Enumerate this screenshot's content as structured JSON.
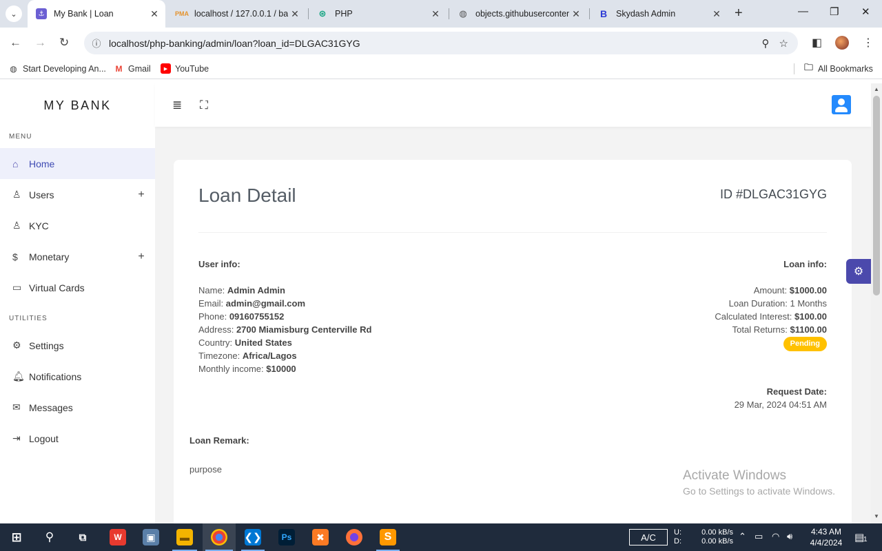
{
  "browser": {
    "tabs": [
      {
        "title": "My Bank | Loan",
        "favicon": "bank-favicon"
      },
      {
        "title": "localhost / 127.0.0.1 / ba",
        "favicon": "phpmyadmin-favicon"
      },
      {
        "title": "PHP",
        "favicon": "chatgpt-favicon"
      },
      {
        "title": "objects.githubusercontent",
        "favicon": "globe-favicon"
      },
      {
        "title": "Skydash Admin",
        "favicon": "bootstrap-favicon"
      }
    ],
    "url": "localhost/php-banking/admin/loan?loan_id=DLGAC31GYG",
    "bookmarks": [
      {
        "label": "Start Developing An..."
      },
      {
        "label": "Gmail"
      },
      {
        "label": "YouTube"
      }
    ],
    "all_bookmarks": "All Bookmarks"
  },
  "sidebar": {
    "brand": "MY BANK",
    "menu_title": "MENU",
    "utilities_title": "UTILITIES",
    "menu_items": [
      {
        "label": "Home",
        "icon": "home-icon"
      },
      {
        "label": "Users",
        "icon": "user-icon",
        "expandable": true
      },
      {
        "label": "KYC",
        "icon": "user-check-icon"
      },
      {
        "label": "Monetary",
        "icon": "dollar-icon",
        "expandable": true
      },
      {
        "label": "Virtual Cards",
        "icon": "card-icon"
      }
    ],
    "utility_items": [
      {
        "label": "Settings",
        "icon": "gear-icon"
      },
      {
        "label": "Notifications",
        "icon": "bell-icon"
      },
      {
        "label": "Messages",
        "icon": "inbox-icon"
      },
      {
        "label": "Logout",
        "icon": "logout-icon"
      }
    ]
  },
  "loan": {
    "title": "Loan Detail",
    "id_label": "ID #DLGAC31GYG",
    "user_info_title": "User info:",
    "user_info": [
      {
        "label": "Name:",
        "value": "Admin Admin"
      },
      {
        "label": "Email:",
        "value": "admin@gmail.com"
      },
      {
        "label": "Phone:",
        "value": "09160755152"
      },
      {
        "label": "Address:",
        "value": "2700 Miamisburg Centerville Rd"
      },
      {
        "label": "Country:",
        "value": "United States"
      },
      {
        "label": "Timezone:",
        "value": "Africa/Lagos"
      },
      {
        "label": "Monthly income:",
        "value": "$10000"
      }
    ],
    "loan_info_title": "Loan info:",
    "amount_label": "Amount:",
    "amount": "$1000.00",
    "duration_label": "Loan Duration:",
    "duration": "1 Months",
    "interest_label": "Calculated Interest:",
    "interest": "$100.00",
    "returns_label": "Total Returns:",
    "returns": "$1100.00",
    "status": "Pending",
    "request_date_label": "Request Date:",
    "request_date": "29 Mar, 2024 04:51 AM",
    "remark_title": "Loan Remark:",
    "remark": "purpose"
  },
  "watermark": {
    "line1": "Activate Windows",
    "line2": "Go to Settings to activate Windows."
  },
  "taskbar": {
    "ac_label": "A/C",
    "upload_label": "U:",
    "download_label": "D:",
    "upload": "0.00 kB/s",
    "download": "0.00 kB/s",
    "time": "4:43 AM",
    "date": "4/4/2024",
    "notification_count": "1"
  },
  "colors": {
    "accent": "#4b49ac",
    "badge_warning": "#ffc100",
    "user_button": "#248afd"
  }
}
